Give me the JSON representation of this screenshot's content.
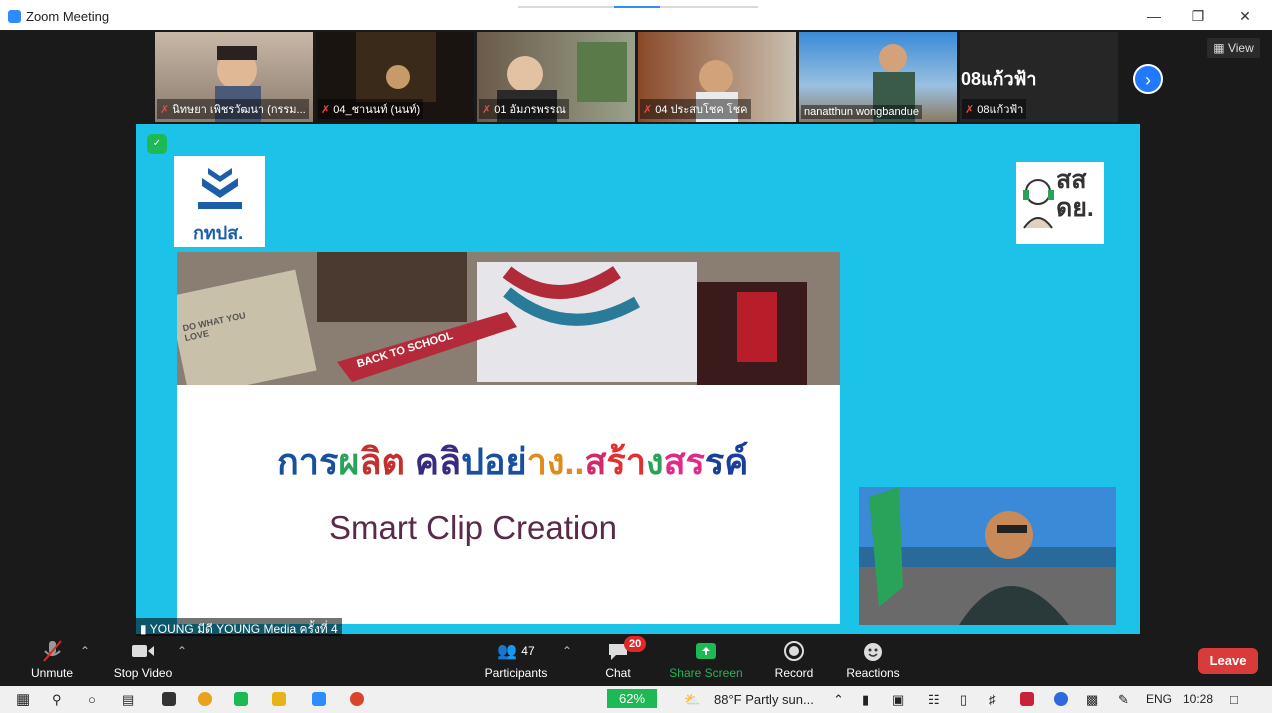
{
  "window": {
    "title": "Zoom Meeting"
  },
  "view_button": "View",
  "participants_strip": [
    {
      "name": "นิทษยา เพิชรวัฒนา (กรรม..."
    },
    {
      "name": "04_ชานนท์ (นนท์)"
    },
    {
      "name": "01 อัมภรพรรณ"
    },
    {
      "name": "04 ประสบโชค โชค"
    },
    {
      "name": "nanatthun wongbandue"
    },
    {
      "name": "08แก้วฟ้า"
    }
  ],
  "active_tile_name": "08แก้วฟ้า",
  "slide": {
    "left_logo_text": "กทปส.",
    "right_logo_text_1": "สส",
    "right_logo_text_2": "ดย.",
    "photo_text_1": "BACK TO SCHOOL",
    "photo_text_2": "DO WHAT YOU LOVE",
    "thai_parts": [
      {
        "t": "การ",
        "color": "#1a4fa0"
      },
      {
        "t": "ผ",
        "color": "#2aa35a"
      },
      {
        "t": "ลิต ",
        "color": "#c23030"
      },
      {
        "t": "คลิ",
        "color": "#3a2a80"
      },
      {
        "t": "ปอย่",
        "color": "#1a4fa0"
      },
      {
        "t": "าง..",
        "color": "#e08a1a"
      },
      {
        "t": "ส",
        "color": "#d12a6a"
      },
      {
        "t": "ร้า",
        "color": "#e23030"
      },
      {
        "t": "ง",
        "color": "#2aa35a"
      },
      {
        "t": "สร",
        "color": "#e02a8a"
      },
      {
        "t": "รค์",
        "color": "#1a3f9a"
      }
    ],
    "english_title": "Smart Clip Creation"
  },
  "speaker_label": "YOUNG มีดี YOUNG Media ครั้งที่ 4",
  "toolbar": {
    "unmute": "Unmute",
    "stop_video": "Stop Video",
    "participants": "Participants",
    "participants_count": "47",
    "chat": "Chat",
    "chat_badge": "20",
    "share_screen": "Share Screen",
    "record": "Record",
    "reactions": "Reactions",
    "leave": "Leave"
  },
  "taskbar": {
    "battery": "62%",
    "weather": "88°F  Partly sun...",
    "language": "ENG",
    "time": "10:28"
  },
  "colors": {
    "zoom_blue": "#2d8cff",
    "share_green": "#1db954",
    "leave_red": "#d93b3b",
    "slide_cyan": "#1cc2e8"
  }
}
